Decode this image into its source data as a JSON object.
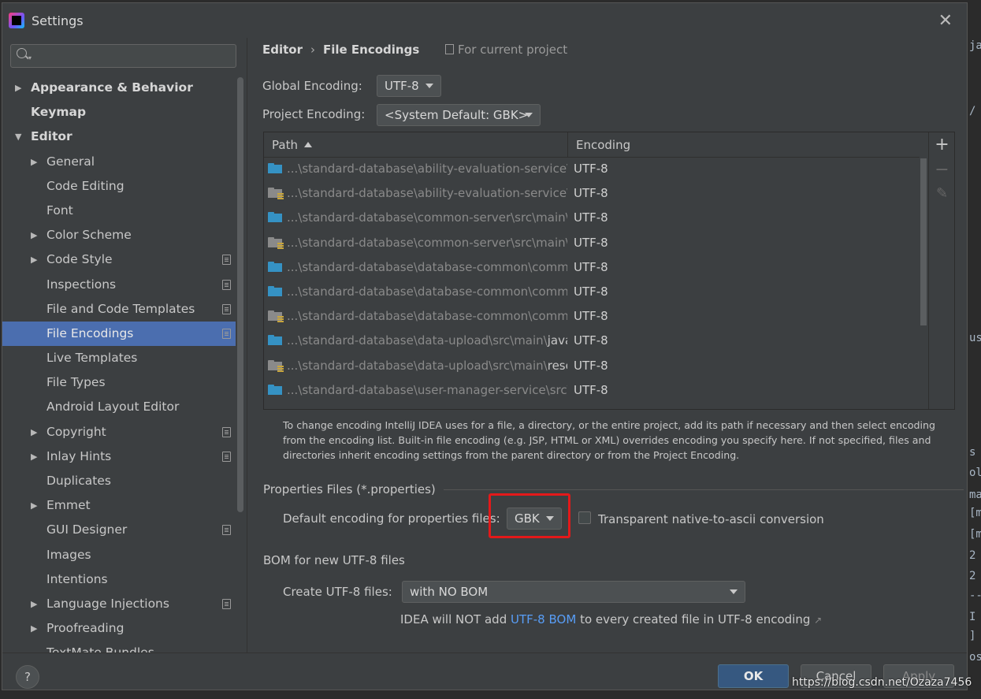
{
  "window": {
    "title": "Settings",
    "close_glyph": "✕"
  },
  "search": {
    "placeholder": "",
    "caret": "▾"
  },
  "tree": [
    {
      "label": "Appearance & Behavior",
      "level": 0,
      "arrow": "▶",
      "bold": true
    },
    {
      "label": "Keymap",
      "level": 0,
      "bold": true
    },
    {
      "label": "Editor",
      "level": 0,
      "arrow": "▼",
      "bold": true
    },
    {
      "label": "General",
      "level": 1,
      "arrow": "▶"
    },
    {
      "label": "Code Editing",
      "level": 1
    },
    {
      "label": "Font",
      "level": 1
    },
    {
      "label": "Color Scheme",
      "level": 1,
      "arrow": "▶"
    },
    {
      "label": "Code Style",
      "level": 1,
      "arrow": "▶",
      "project": true
    },
    {
      "label": "Inspections",
      "level": 1,
      "project": true
    },
    {
      "label": "File and Code Templates",
      "level": 1,
      "project": true
    },
    {
      "label": "File Encodings",
      "level": 1,
      "project": true,
      "selected": true
    },
    {
      "label": "Live Templates",
      "level": 1
    },
    {
      "label": "File Types",
      "level": 1
    },
    {
      "label": "Android Layout Editor",
      "level": 1
    },
    {
      "label": "Copyright",
      "level": 1,
      "arrow": "▶",
      "project": true
    },
    {
      "label": "Inlay Hints",
      "level": 1,
      "arrow": "▶",
      "project": true
    },
    {
      "label": "Duplicates",
      "level": 1
    },
    {
      "label": "Emmet",
      "level": 1,
      "arrow": "▶"
    },
    {
      "label": "GUI Designer",
      "level": 1,
      "project": true
    },
    {
      "label": "Images",
      "level": 1
    },
    {
      "label": "Intentions",
      "level": 1
    },
    {
      "label": "Language Injections",
      "level": 1,
      "arrow": "▶",
      "project": true
    },
    {
      "label": "Proofreading",
      "level": 1,
      "arrow": "▶"
    },
    {
      "label": "TextMate Bundles",
      "level": 1
    }
  ],
  "breadcrumb": {
    "parent": "Editor",
    "separator": "›",
    "current": "File Encodings",
    "scope": "For current project"
  },
  "global_encoding": {
    "label": "Global Encoding:",
    "value": "UTF-8"
  },
  "project_encoding": {
    "label": "Project Encoding:",
    "value": "<System Default: GBK>"
  },
  "table": {
    "headers": {
      "path": "Path",
      "encoding": "Encoding"
    },
    "rows": [
      {
        "path": "...\\standard-database\\ability-evaluation-service\\s",
        "encoding": "UTF-8",
        "icon": "source-folder-icon",
        "res": false
      },
      {
        "path": "...\\standard-database\\ability-evaluation-service\\s",
        "encoding": "UTF-8",
        "icon": "resources-folder-icon",
        "res": true
      },
      {
        "path": "...\\standard-database\\common-server\\src\\main\\",
        "encoding": "UTF-8",
        "icon": "source-folder-icon",
        "res": false
      },
      {
        "path": "...\\standard-database\\common-server\\src\\main\\",
        "encoding": "UTF-8",
        "icon": "resources-folder-icon",
        "res": true
      },
      {
        "path": "...\\standard-database\\database-common\\commc",
        "encoding": "UTF-8",
        "icon": "source-folder-icon",
        "res": false
      },
      {
        "path": "...\\standard-database\\database-common\\commc",
        "encoding": "UTF-8",
        "icon": "source-folder-icon",
        "res": false
      },
      {
        "path": "...\\standard-database\\database-common\\commc",
        "encoding": "UTF-8",
        "icon": "resources-folder-icon",
        "res": true
      },
      {
        "path": "...\\standard-database\\data-upload\\src\\main\\",
        "tail": "java",
        "encoding": "UTF-8",
        "icon": "source-folder-icon",
        "res": false
      },
      {
        "path": "...\\standard-database\\data-upload\\src\\main\\",
        "tail": "reso",
        "encoding": "UTF-8",
        "icon": "resources-folder-icon",
        "res": true
      },
      {
        "path": "...\\standard-database\\user-manager-service\\src\\r",
        "encoding": "UTF-8",
        "icon": "source-folder-icon",
        "res": false
      }
    ],
    "toolbar": {
      "add": "+",
      "remove": "−",
      "edit": "✎"
    }
  },
  "help_text": "To change encoding IntelliJ IDEA uses for a file, a directory, or the entire project, add its path if necessary and then select encoding from the encoding list. Built-in file encoding (e.g. JSP, HTML or XML) overrides encoding you specify here. If not specified, files and directories inherit encoding settings from the parent directory or from the Project Encoding.",
  "properties": {
    "section": "Properties Files (*.properties)",
    "default_label": "Default encoding for properties files:",
    "default_value": "GBK",
    "transparent_label": "Transparent native-to-ascii conversion",
    "transparent_checked": false
  },
  "bom": {
    "section": "BOM for new UTF-8 files",
    "create_label": "Create UTF-8 files:",
    "create_value": "with NO BOM",
    "note_prefix": "IDEA will NOT add",
    "note_link": "UTF-8 BOM",
    "note_suffix": "to every created file in UTF-8 encoding",
    "note_arrow": "↗"
  },
  "footer": {
    "help": "?",
    "ok": "OK",
    "cancel": "Cancel",
    "apply": "Apply"
  },
  "watermark": "https://blog.csdn.net/Ozaza7456",
  "editor_peek": [
    "ja",
    "/",
    "us",
    "s",
    "ol",
    "ma",
    "[m",
    "[m",
    "2",
    "2",
    "--",
    "I",
    "]",
    "os"
  ],
  "colors": {
    "selection": "#4b6eaf",
    "link": "#589df6",
    "highlight_box": "#e3191a",
    "ok_button": "#365880"
  }
}
